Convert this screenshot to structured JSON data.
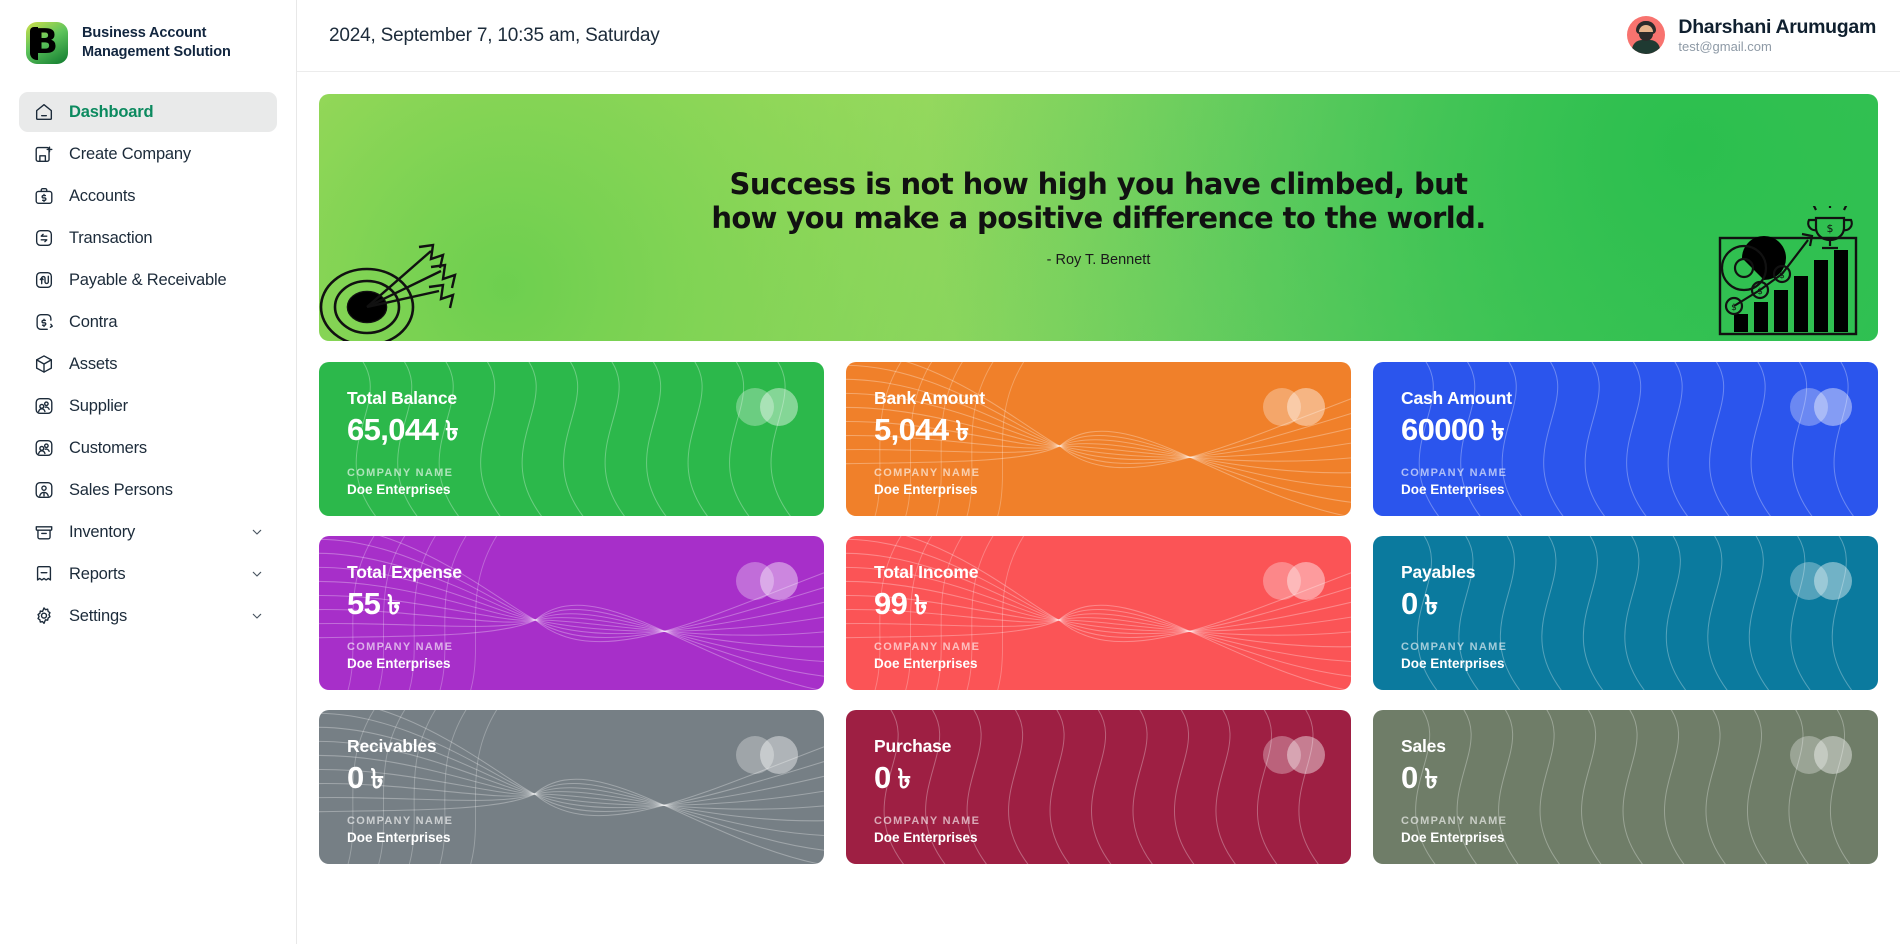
{
  "brand": {
    "logo_icon": "b-logo-icon",
    "title_line1": "Business Account",
    "title_line2": "Management Solution"
  },
  "sidebar": {
    "items": [
      {
        "label": "Dashboard",
        "icon": "home-icon",
        "active": true,
        "expandable": false
      },
      {
        "label": "Create Company",
        "icon": "building-plus-icon",
        "active": false,
        "expandable": false
      },
      {
        "label": "Accounts",
        "icon": "briefcase-dollar-icon",
        "active": false,
        "expandable": false
      },
      {
        "label": "Transaction",
        "icon": "exchange-icon",
        "active": false,
        "expandable": false
      },
      {
        "label": "Payable & Receivable",
        "icon": "arrows-updown-icon",
        "active": false,
        "expandable": false
      },
      {
        "label": "Contra",
        "icon": "dollar-refresh-icon",
        "active": false,
        "expandable": false
      },
      {
        "label": "Assets",
        "icon": "box-icon",
        "active": false,
        "expandable": false
      },
      {
        "label": "Supplier",
        "icon": "users-icon",
        "active": false,
        "expandable": false
      },
      {
        "label": "Customers",
        "icon": "users-icon",
        "active": false,
        "expandable": false
      },
      {
        "label": "Sales Persons",
        "icon": "user-icon",
        "active": false,
        "expandable": false
      },
      {
        "label": "Inventory",
        "icon": "archive-icon",
        "active": false,
        "expandable": true
      },
      {
        "label": "Reports",
        "icon": "receipt-icon",
        "active": false,
        "expandable": true
      },
      {
        "label": "Settings",
        "icon": "gear-icon",
        "active": false,
        "expandable": true
      }
    ]
  },
  "topbar": {
    "datetime": "2024, September 7, 10:35 am, Saturday",
    "user": {
      "name": "Dharshani Arumugam",
      "email": "test@gmail.com",
      "avatar_icon": "avatar"
    }
  },
  "banner": {
    "quote": "Success is not how high you have climbed, but how you make a positive difference to the world.",
    "author": "- Roy T. Bennett",
    "art_left_icon": "target-arrows-icon",
    "art_right_icon": "growth-chart-trophy-icon",
    "gradient_from": "#e2e86a",
    "gradient_to": "#36c158"
  },
  "company_label": "COMPANY NAME",
  "cards": [
    {
      "title": "Total Balance",
      "value": "65,044",
      "currency": "৳",
      "company": "Doe Enterprises",
      "color": "#2cb84b",
      "pattern": "waves"
    },
    {
      "title": "Bank Amount",
      "value": "5,044",
      "currency": "৳",
      "company": "Doe Enterprises",
      "color": "#f0802a",
      "pattern": "swirl"
    },
    {
      "title": "Cash Amount",
      "value": "60000",
      "currency": "৳",
      "company": "Doe Enterprises",
      "color": "#2b55ed",
      "pattern": "waves"
    },
    {
      "title": "Total Expense",
      "value": "55",
      "currency": "৳",
      "company": "Doe Enterprises",
      "color": "#a72fc9",
      "pattern": "swirl"
    },
    {
      "title": "Total Income",
      "value": "99",
      "currency": "৳",
      "company": "Doe Enterprises",
      "color": "#fb5456",
      "pattern": "swirl"
    },
    {
      "title": "Payables",
      "value": "0",
      "currency": "৳",
      "company": "Doe Enterprises",
      "color": "#0b7a9e",
      "pattern": "waves"
    },
    {
      "title": "Recivables",
      "value": "0",
      "currency": "৳",
      "company": "Doe Enterprises",
      "color": "#767f85",
      "pattern": "swirl"
    },
    {
      "title": "Purchase",
      "value": "0",
      "currency": "৳",
      "company": "Doe Enterprises",
      "color": "#9e1f43",
      "pattern": "waves"
    },
    {
      "title": "Sales",
      "value": "0",
      "currency": "৳",
      "company": "Doe Enterprises",
      "color": "#6f7d68",
      "pattern": "waves"
    }
  ]
}
